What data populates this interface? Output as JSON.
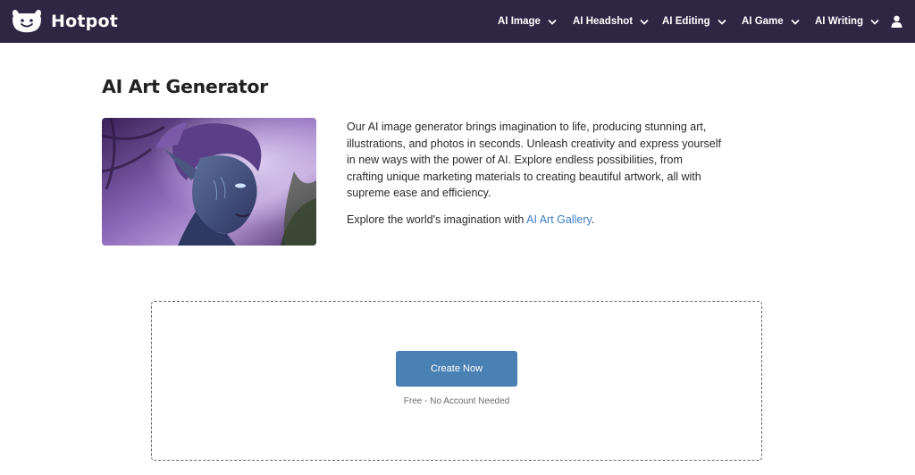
{
  "header": {
    "brand": "Hotpot",
    "nav": [
      {
        "label": "AI Image"
      },
      {
        "label": "AI Headshot"
      },
      {
        "label": "AI Editing"
      },
      {
        "label": "AI Game"
      },
      {
        "label": "AI Writing"
      }
    ],
    "icons": {
      "logo": "hotpot-logo-icon",
      "chevron": "chevron-down-icon",
      "account": "user-icon"
    }
  },
  "main": {
    "title": "AI Art Generator",
    "description": "Our AI image generator brings imagination to life, producing stunning art, illustrations, and photos in seconds. Unleash creativity and express yourself in new ways with the power of AI. Explore endless possibilities, from crafting unique marketing materials to creating beautiful artwork, all with supreme ease and efficiency.",
    "explore_prefix": "Explore the world's imagination with ",
    "explore_link": "AI Art Gallery",
    "explore_suffix": "."
  },
  "create": {
    "button_label": "Create Now",
    "note": "Free - No Account Needed"
  },
  "colors": {
    "topbar": "#2f2643",
    "button": "#4a81b4",
    "link": "#3f7fc4"
  }
}
